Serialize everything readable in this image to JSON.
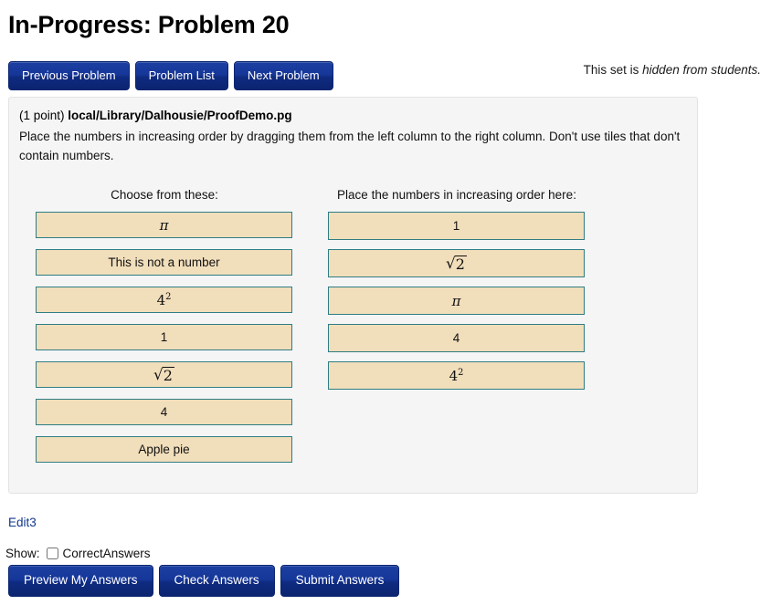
{
  "page": {
    "title": "In-Progress: Problem 20",
    "hidden_notice_prefix": "This set is ",
    "hidden_notice_emphasis": "hidden from students."
  },
  "nav": {
    "previous_label": "Previous Problem",
    "list_label": "Problem List",
    "next_label": "Next Problem"
  },
  "problem": {
    "points": "(1 point)",
    "source": "local/Library/Dalhousie/ProofDemo.pg",
    "instructions": "Place the numbers in increasing order by dragging them from the left column to the right column. Don't use tiles that don't contain numbers.",
    "left_column_header": "Choose from these:",
    "right_column_header": "Place the numbers in increasing order here:",
    "left_tiles": [
      {
        "text": "π",
        "kind": "math-pi"
      },
      {
        "text": "This is not a number",
        "kind": "plain"
      },
      {
        "text": "4^2",
        "kind": "math-power",
        "base": "4",
        "exponent": "2"
      },
      {
        "text": "1",
        "kind": "plain"
      },
      {
        "text": "√2",
        "kind": "math-sqrt",
        "radicand": "2"
      },
      {
        "text": "4",
        "kind": "plain"
      },
      {
        "text": "Apple pie",
        "kind": "plain"
      }
    ],
    "right_tiles": [
      {
        "text": "1",
        "kind": "plain"
      },
      {
        "text": "√2",
        "kind": "math-sqrt",
        "radicand": "2"
      },
      {
        "text": "π",
        "kind": "math-pi"
      },
      {
        "text": "4",
        "kind": "plain"
      },
      {
        "text": "4^2",
        "kind": "math-power",
        "base": "4",
        "exponent": "2"
      }
    ]
  },
  "footer": {
    "edit_link": "Edit3",
    "show_label": "Show:",
    "show_checkbox_label": "CorrectAnswers",
    "show_checkbox_checked": false,
    "preview_label": "Preview My Answers",
    "check_label": "Check Answers",
    "submit_label": "Submit Answers"
  },
  "colors": {
    "button_navy": "#132f8f",
    "tile_border_teal": "#2f7d84",
    "tile_fill_wheat": "#f1debb",
    "panel_background": "#f5f5f5",
    "link_blue": "#11388c"
  }
}
